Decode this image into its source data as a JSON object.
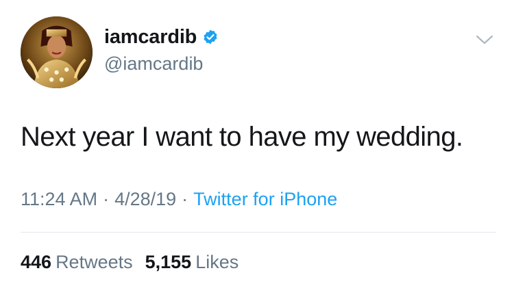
{
  "user": {
    "display_name": "iamcardib",
    "handle": "@iamcardib",
    "verified": true,
    "avatar_icon": "avatar-photo"
  },
  "tweet": {
    "text": "Next year I want to have my wedding.",
    "time": "11:24 AM",
    "date": "4/28/19",
    "separator": "·",
    "source": "Twitter for iPhone"
  },
  "stats": {
    "retweets_count": "446",
    "retweets_label": "Retweets",
    "likes_count": "5,155",
    "likes_label": "Likes"
  },
  "colors": {
    "text_primary": "#14171a",
    "text_secondary": "#657786",
    "accent": "#1da1f2",
    "divider": "#e1e8ed",
    "background": "#ffffff"
  },
  "icons": {
    "verified": "verified-badge-icon",
    "menu": "chevron-down-icon"
  }
}
